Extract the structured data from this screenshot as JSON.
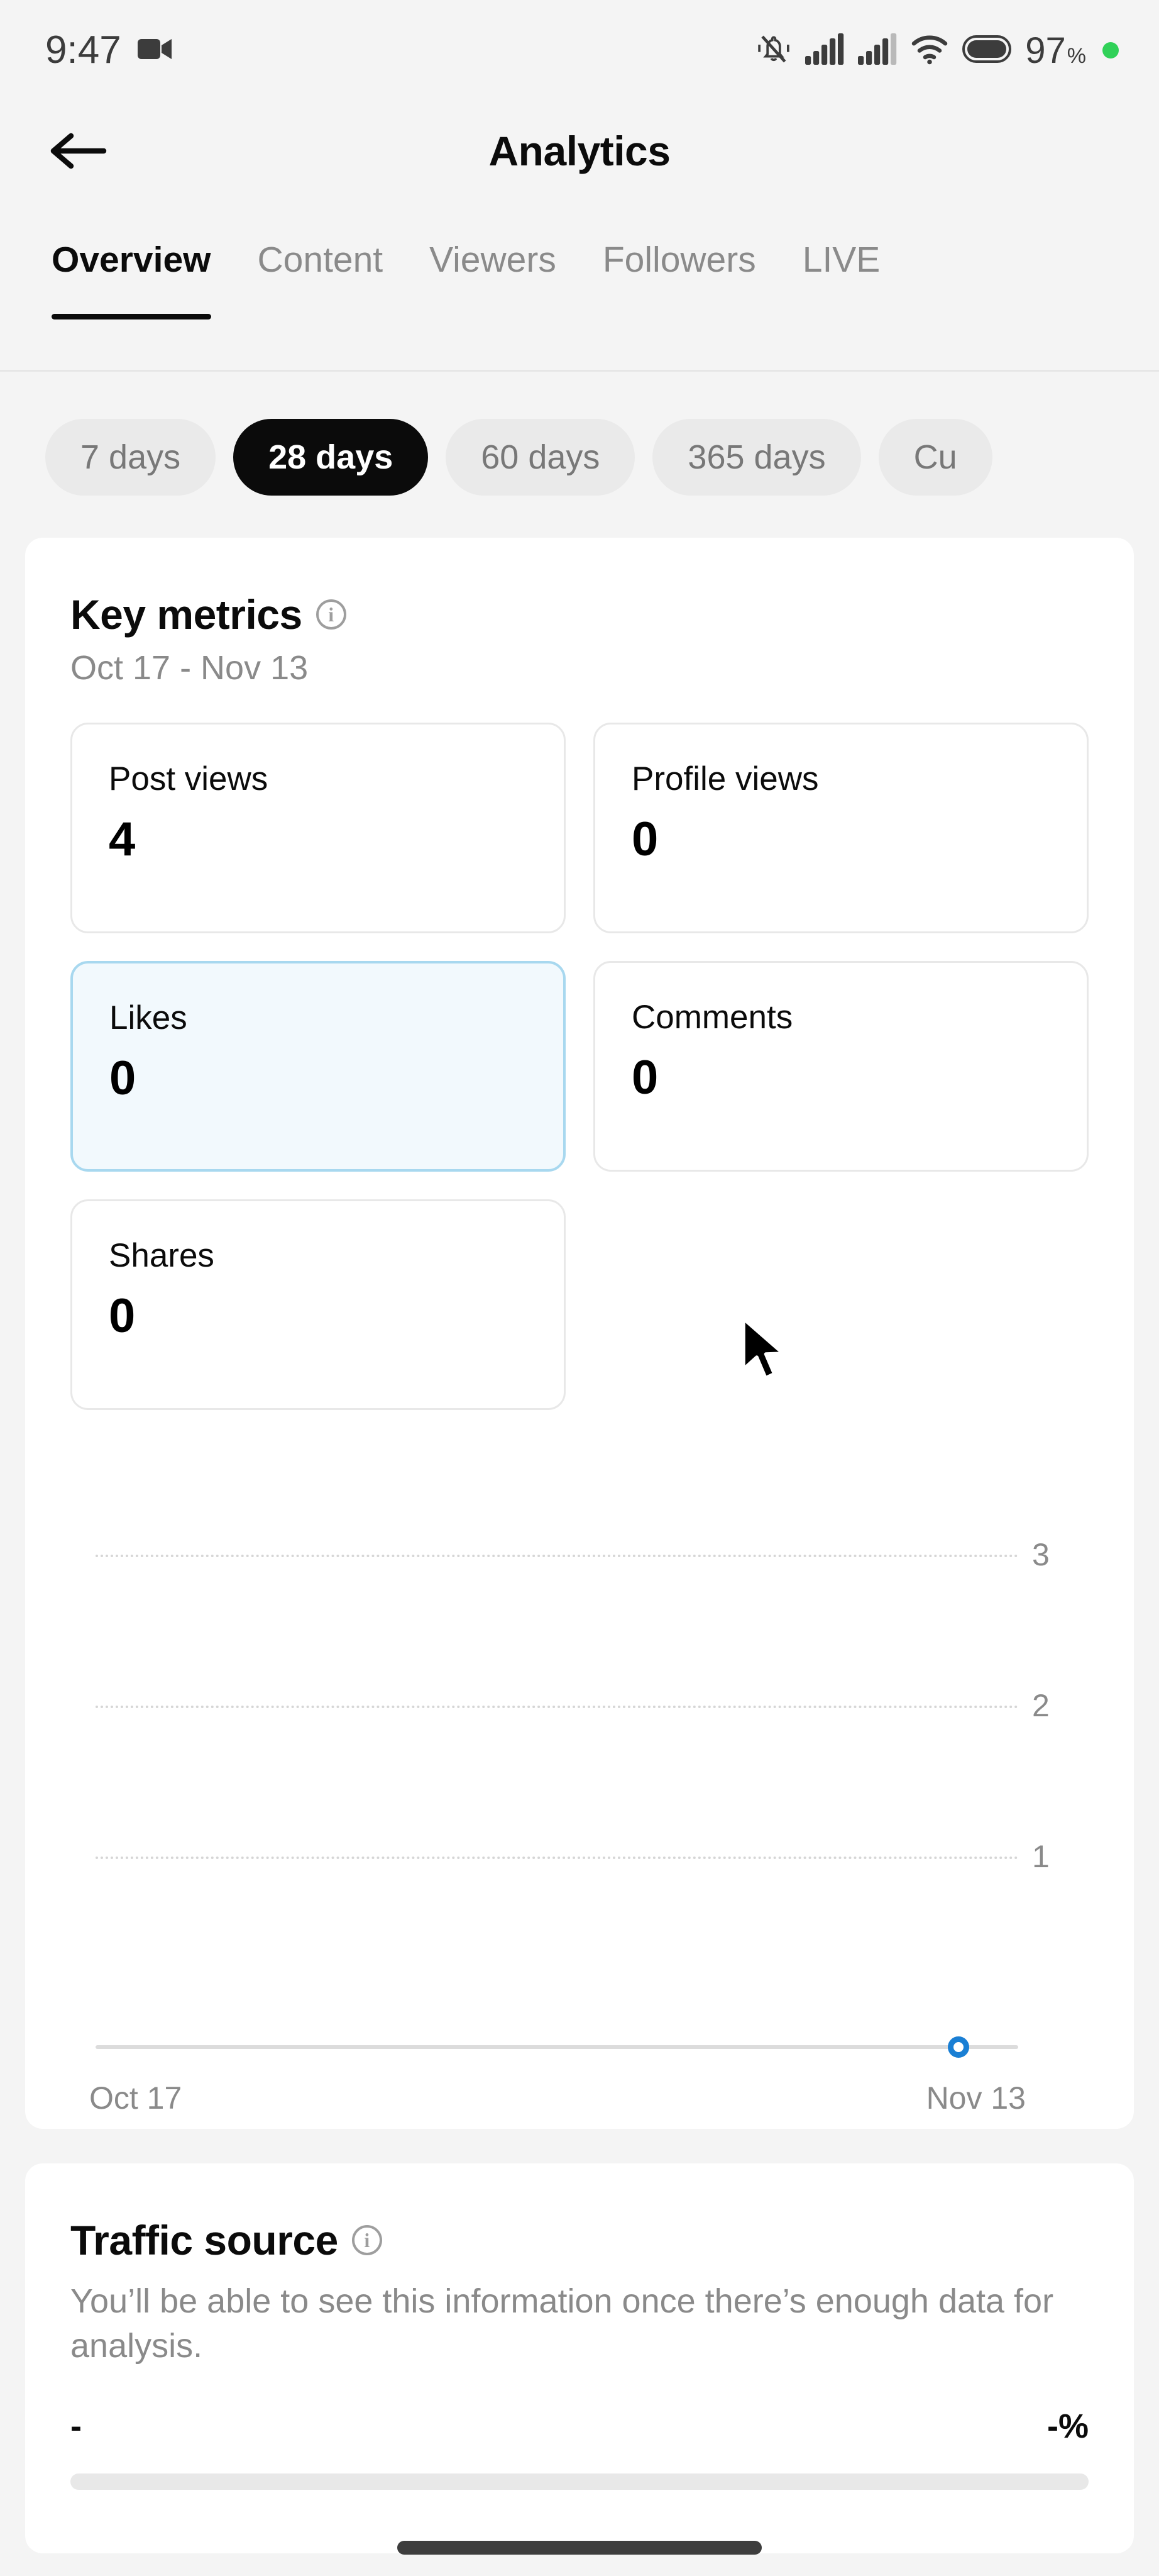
{
  "status_bar": {
    "time": "9:47",
    "battery_percent": "97",
    "percent_symbol": "%",
    "icons": [
      "video-camera-icon",
      "bell-mute-icon",
      "signal-bars-icon-1",
      "signal-bars-icon-2",
      "wifi-icon",
      "battery-icon",
      "green-status-dot"
    ]
  },
  "header": {
    "title": "Analytics",
    "back_icon": "back-arrow-icon"
  },
  "tabs": [
    {
      "label": "Overview",
      "active": true
    },
    {
      "label": "Content",
      "active": false
    },
    {
      "label": "Viewers",
      "active": false
    },
    {
      "label": "Followers",
      "active": false
    },
    {
      "label": "LIVE",
      "active": false
    }
  ],
  "date_pills": [
    {
      "label": "7 days",
      "active": false
    },
    {
      "label": "28 days",
      "active": true
    },
    {
      "label": "60 days",
      "active": false
    },
    {
      "label": "365 days",
      "active": false
    },
    {
      "label": "Cu",
      "active": false
    }
  ],
  "key_metrics": {
    "title": "Key metrics",
    "date_range": "Oct 17 - Nov 13",
    "info_glyph": "i",
    "tiles": [
      {
        "label": "Post views",
        "value": "4",
        "selected": false
      },
      {
        "label": "Profile views",
        "value": "0",
        "selected": false
      },
      {
        "label": "Likes",
        "value": "0",
        "selected": true
      },
      {
        "label": "Comments",
        "value": "0",
        "selected": false
      },
      {
        "label": "Shares",
        "value": "0",
        "selected": false
      }
    ]
  },
  "traffic_source": {
    "title": "Traffic source",
    "info_glyph": "i",
    "description": "You’ll be able to see this information once there’s enough data for analysis.",
    "row_label": "-",
    "row_value": "-%"
  },
  "colors": {
    "accent_blue": "#1a7fd4",
    "selected_tile_bg": "#f2f9fd",
    "selected_tile_border": "#a8d8ef",
    "page_bg": "#f4f4f4",
    "card_bg": "#ffffff",
    "active_pill_bg": "#0b0b0b",
    "muted_text": "#8a8a8a",
    "battery_dot_green": "#30d158"
  },
  "chart_data": {
    "type": "line",
    "title": "Likes",
    "x": [
      "Oct 17",
      "Nov 13"
    ],
    "xlabel": "",
    "ylabel": "",
    "tick_labels": [
      "3",
      "2",
      "1"
    ],
    "tick_values": [
      3,
      2,
      1
    ],
    "ylim": [
      0,
      3.4
    ],
    "grid": true,
    "grid_style": "dotted",
    "legend": "none",
    "series": [
      {
        "name": "Likes",
        "values": [
          0,
          0
        ],
        "color": "#1a7fd4",
        "flat_at": 0,
        "marker_at_x_fraction": 0.935,
        "marker_value": 0
      }
    ],
    "x_axis_start_label": "Oct 17",
    "x_axis_end_label": "Nov 13"
  }
}
